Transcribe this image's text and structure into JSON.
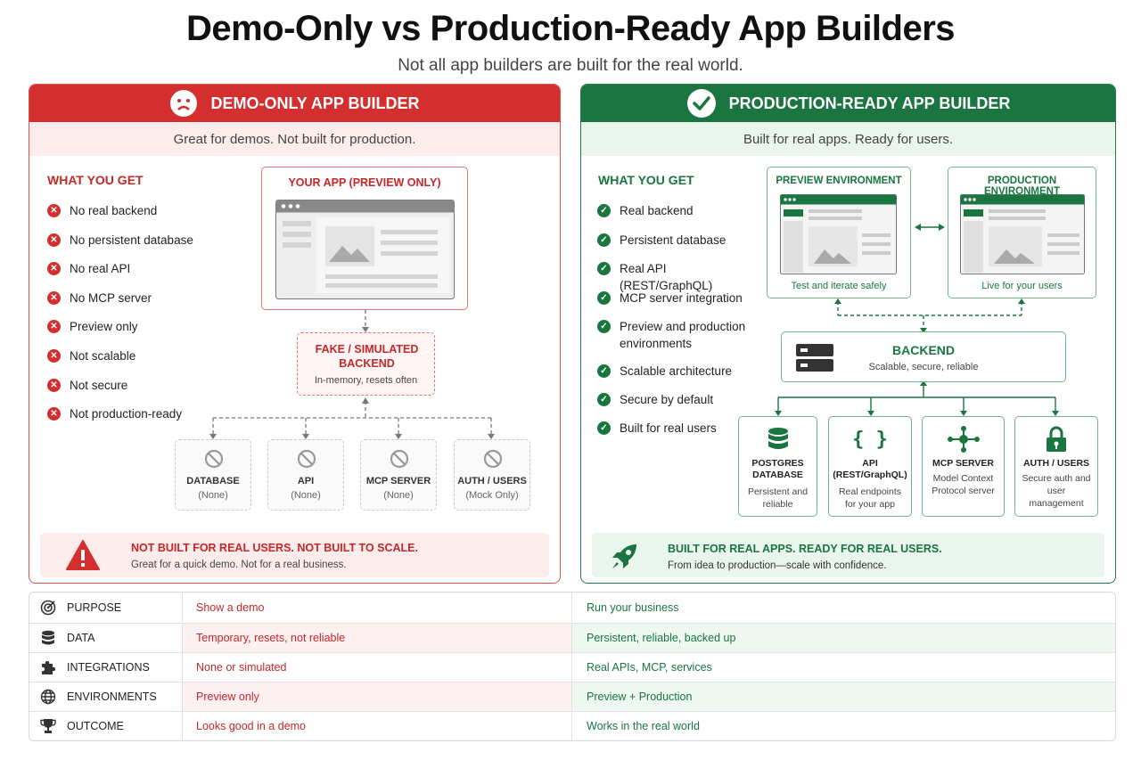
{
  "title": "Demo-Only vs Production-Ready App Builders",
  "subtitle": "Not all app builders are built for the real world.",
  "demo": {
    "header": "DEMO-ONLY APP BUILDER",
    "tagline": "Great for demos. Not built for production.",
    "what_you_get": "WHAT YOU GET",
    "features": [
      "No real backend",
      "No persistent database",
      "No real API",
      "No MCP server",
      "Preview only",
      "Not scalable",
      "Not secure",
      "Not production-ready"
    ],
    "app_box_title": "YOUR APP (PREVIEW ONLY)",
    "backend_title": "FAKE / SIMULATED BACKEND",
    "backend_sub": "In-memory, resets often",
    "services": [
      {
        "name": "DATABASE",
        "sub": "(None)"
      },
      {
        "name": "API",
        "sub": "(None)"
      },
      {
        "name": "MCP SERVER",
        "sub": "(None)"
      },
      {
        "name": "AUTH / USERS",
        "sub": "(Mock Only)"
      }
    ],
    "banner_title": "NOT BUILT FOR REAL USERS. NOT BUILT TO SCALE.",
    "banner_sub": "Great for a quick demo. Not for a real business."
  },
  "prod": {
    "header": "PRODUCTION-READY APP BUILDER",
    "tagline": "Built for real apps. Ready for users.",
    "what_you_get": "WHAT YOU GET",
    "features": [
      "Real backend",
      "Persistent database",
      "Real API (REST/GraphQL)",
      "MCP server integration",
      "Preview and production environments",
      "Scalable architecture",
      "Secure by default",
      "Built for real users"
    ],
    "preview_env": {
      "title": "PREVIEW ENVIRONMENT",
      "caption": "Test and iterate safely"
    },
    "production_env": {
      "title": "PRODUCTION ENVIRONMENT",
      "caption": "Live for your users"
    },
    "backend_title": "BACKEND",
    "backend_sub": "Scalable, secure, reliable",
    "services": [
      {
        "name": "POSTGRES DATABASE",
        "sub": "Persistent and reliable"
      },
      {
        "name": "API (REST/GraphQL)",
        "sub": "Real endpoints for your app"
      },
      {
        "name": "MCP SERVER",
        "sub": "Model Context Protocol server"
      },
      {
        "name": "AUTH / USERS",
        "sub": "Secure auth and user management"
      }
    ],
    "banner_title": "BUILT FOR REAL APPS. READY FOR REAL USERS.",
    "banner_sub": "From idea to production—scale with confidence."
  },
  "comparison": [
    {
      "label": "PURPOSE",
      "icon": "target-icon",
      "demo": "Show a demo",
      "prod": "Run your business"
    },
    {
      "label": "DATA",
      "icon": "database-icon",
      "demo": "Temporary, resets, not reliable",
      "prod": "Persistent, reliable, backed up"
    },
    {
      "label": "INTEGRATIONS",
      "icon": "puzzle-icon",
      "demo": "None or simulated",
      "prod": "Real APIs, MCP, services"
    },
    {
      "label": "ENVIRONMENTS",
      "icon": "globe-icon",
      "demo": "Preview only",
      "prod": "Preview + Production"
    },
    {
      "label": "OUTCOME",
      "icon": "trophy-icon",
      "demo": "Looks good in a demo",
      "prod": "Works in the real world"
    }
  ],
  "colors": {
    "red": "#d32f2f",
    "green": "#1a7541"
  }
}
